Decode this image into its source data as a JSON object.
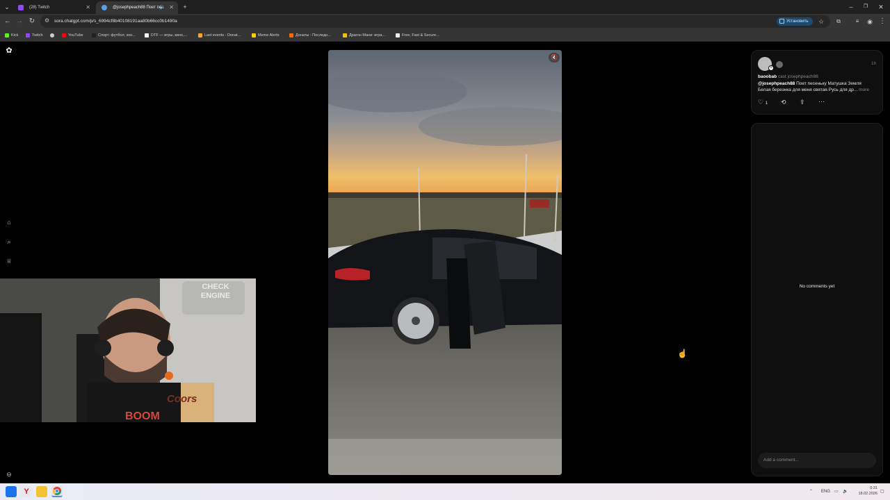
{
  "browser": {
    "tabs": [
      {
        "label": "(28) Twitch",
        "active": false
      },
      {
        "label": "@josephpeach88 Поет пес",
        "active": true
      }
    ],
    "url": "sora.chatgpt.com/p/s_6994cf8b40108191aa80b66cc0b1490a",
    "install_label": "Установить",
    "bookmarks": [
      {
        "label": "Kick",
        "color": "#53fc18"
      },
      {
        "label": "Twitch",
        "color": "#9146ff"
      },
      {
        "label": "",
        "color": "#cccccc"
      },
      {
        "label": "YouTube",
        "color": "#ff0000"
      },
      {
        "label": "Спорт: футбол, хок...",
        "color": "#222222"
      },
      {
        "label": "DTF — игры, кино,...",
        "color": "#ffffff"
      },
      {
        "label": "Last events - Donat...",
        "color": "#f5a623"
      },
      {
        "label": "Meme Alerts",
        "color": "#ffcc00"
      },
      {
        "label": "Донаты - Последн...",
        "color": "#ff6a00"
      },
      {
        "label": "Драгон Мани: игра...",
        "color": "#f2c200"
      },
      {
        "label": "Free, Fast & Secure...",
        "color": "#eeeeee"
      }
    ]
  },
  "post": {
    "username": "baoobab",
    "cast_label": "cast josephpeach88",
    "time": "1h",
    "mention": "@josephpeach88",
    "caption_line1": "Поет песеньку Матушка Земля",
    "caption_line2": "Белая березнка для меня святая Русь для др...",
    "more_label": "more",
    "like_count": "1"
  },
  "comments": {
    "empty_label": "No comments yet",
    "input_placeholder": "Add a comment..."
  },
  "webcam": {
    "sign_line1": "CHECK",
    "sign_line2": "ENGINE",
    "box_text": "Coors"
  },
  "taskbar": {
    "lang": "ENG",
    "time": "0:31",
    "date": "18.02.2026"
  },
  "colors": {
    "accent": "#1d4a6e",
    "panel_bg": "#0f0f0f"
  }
}
